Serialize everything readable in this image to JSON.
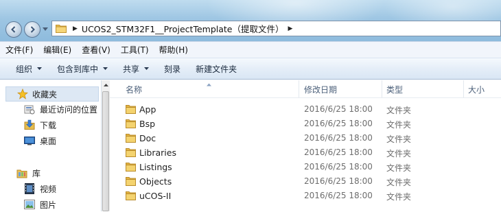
{
  "address": {
    "path": "UCOS2_STM32F1__ProjectTemplate（提取文件）"
  },
  "menu": [
    "文件(F)",
    "编辑(E)",
    "查看(V)",
    "工具(T)",
    "帮助(H)"
  ],
  "commands": {
    "organize": "组织",
    "include_in_library": "包含到库中",
    "share": "共享",
    "burn": "刻录",
    "new_folder": "新建文件夹"
  },
  "nav": {
    "favorites": "收藏夹",
    "recent": "最近访问的位置",
    "downloads": "下载",
    "desktop": "桌面",
    "library": "库",
    "videos": "视频",
    "pictures": "图片"
  },
  "columns": {
    "name": "名称",
    "modified": "修改日期",
    "type": "类型",
    "size": "大小"
  },
  "files": [
    {
      "name": "App",
      "date": "2016/6/25 18:00",
      "type": "文件夹",
      "icon": "folder-icon"
    },
    {
      "name": "Bsp",
      "date": "2016/6/25 18:00",
      "type": "文件夹",
      "icon": "folder-icon"
    },
    {
      "name": "Doc",
      "date": "2016/6/25 18:00",
      "type": "文件夹",
      "icon": "folder-icon"
    },
    {
      "name": "Libraries",
      "date": "2016/6/25 18:00",
      "type": "文件夹",
      "icon": "folder-icon"
    },
    {
      "name": "Listings",
      "date": "2016/6/25 18:00",
      "type": "文件夹",
      "icon": "folder-icon"
    },
    {
      "name": "Objects",
      "date": "2016/6/25 18:00",
      "type": "文件夹",
      "icon": "folder-icon"
    },
    {
      "name": "uCOS-II",
      "date": "2016/6/25 18:00",
      "type": "文件夹",
      "icon": "folder-icon"
    }
  ]
}
